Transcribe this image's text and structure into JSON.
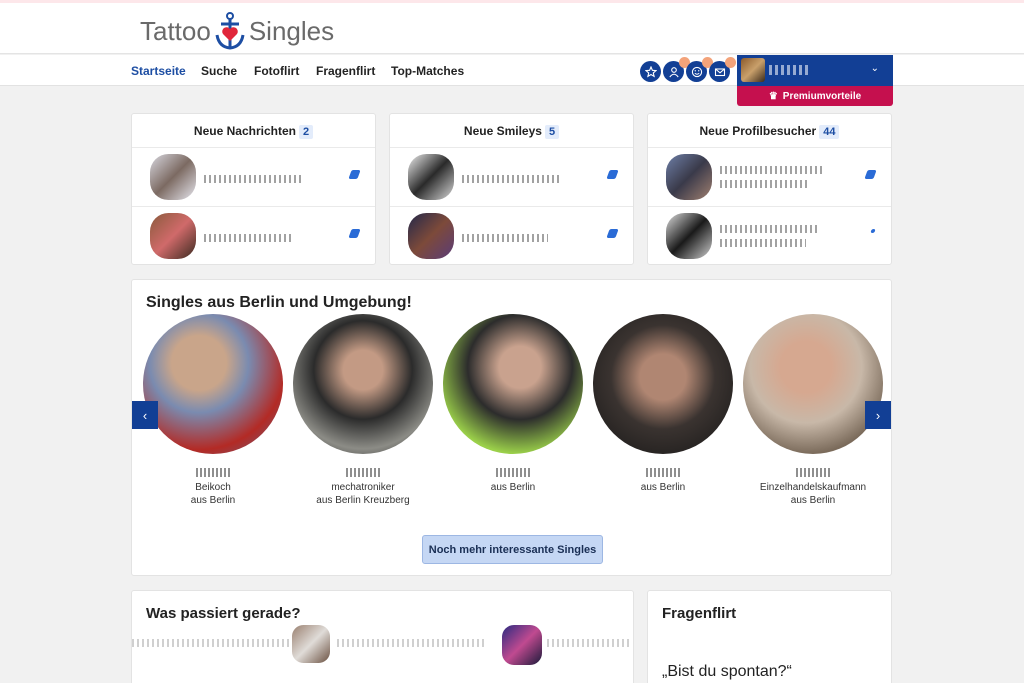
{
  "header": {
    "logo_left": "Tattoo",
    "logo_right": "Singles"
  },
  "nav": {
    "items": [
      "Startseite",
      "Suche",
      "Fotoflirt",
      "Fragenflirt",
      "Top-Matches"
    ],
    "active": "Startseite",
    "icons": [
      "star-icon",
      "user-icon",
      "smiley-icon",
      "mail-icon"
    ]
  },
  "premium_label": "Premiumvorteile",
  "panels": [
    {
      "title": "Neue Nachrichten",
      "count": "2"
    },
    {
      "title": "Neue Smileys",
      "count": "5"
    },
    {
      "title": "Neue Profilbesucher",
      "count": "44"
    }
  ],
  "singles": {
    "title": "Singles aus Berlin und Umgebung!",
    "people": [
      {
        "line1": "Beikoch",
        "line2": "aus Berlin"
      },
      {
        "line1": "mechatroniker",
        "line2": "aus Berlin Kreuzberg"
      },
      {
        "line1": "aus Berlin",
        "line2": ""
      },
      {
        "line1": "aus Berlin",
        "line2": ""
      },
      {
        "line1": "Einzelhandelskaufmann",
        "line2": "aus Berlin"
      }
    ],
    "more_button": "Noch mehr interessante Singles"
  },
  "activity": {
    "title": "Was passiert gerade?"
  },
  "fragenflirt": {
    "title": "Fragenflirt",
    "question": "„Bist du spontan?“"
  },
  "colors": {
    "brand": "#123f95",
    "premium": "#c5104e",
    "accent_text": "#1d4ea3"
  }
}
